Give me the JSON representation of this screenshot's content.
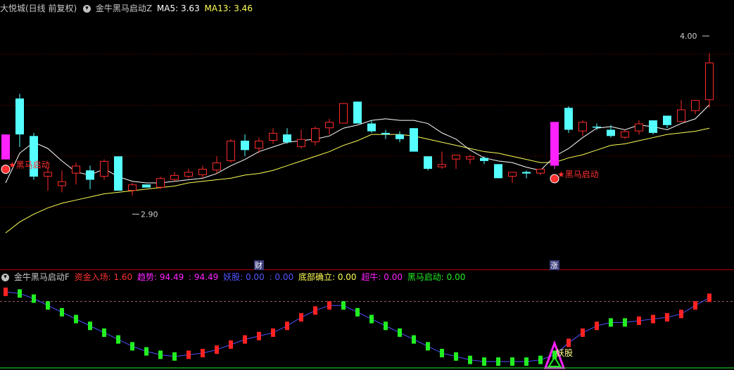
{
  "header_top": {
    "stock": "大悦城(日线 前复权)",
    "indicator": "金牛黑马启动Z",
    "ma5_label": "MA5:",
    "ma5_value": "3.63",
    "ma13_label": "MA13:",
    "ma13_value": "3.46"
  },
  "header_bottom": {
    "indicator": "金牛黑马启动F",
    "funds_label": "资金入场:",
    "funds_value": "1.60",
    "trend_label": "趋势:",
    "trend_value1": "94.49",
    "trend_value2": "94.49",
    "yao_label": "妖股:",
    "yao_value1": "0.00",
    "yao_value2": "0.00",
    "bottom_label": "底部确立:",
    "bottom_value": "0.00",
    "super_label": "超牛:",
    "super_value": "0.00",
    "hm_label": "黑马启动:",
    "hm_value": "0.00"
  },
  "annotations": {
    "high_price": "4.00",
    "low_price": "2.90",
    "signal_text": "★黑马启动",
    "event_cai": "财",
    "event_zhang": "涨",
    "yao_text": "妖股"
  },
  "colors": {
    "up": "#ff2a2a",
    "down": "#55ffff",
    "signal": "#ff22ff",
    "ma5": "#ffffff",
    "ma13": "#ffff55",
    "separator": "#b00000",
    "green_bar": "#22ee22",
    "red_bar": "#ff2222"
  },
  "chart_data": {
    "type": "candlestick",
    "candles": [
      {
        "o": 3.26,
        "c": 3.42,
        "h": 3.42,
        "l": 3.26,
        "color": "signal"
      },
      {
        "o": 3.65,
        "c": 3.42,
        "h": 3.68,
        "l": 3.34,
        "color": "down"
      },
      {
        "o": 3.41,
        "c": 3.15,
        "h": 3.43,
        "l": 3.13,
        "color": "down"
      },
      {
        "o": 3.15,
        "c": 3.18,
        "h": 3.21,
        "l": 3.06,
        "color": "up"
      },
      {
        "o": 3.09,
        "c": 3.12,
        "h": 3.19,
        "l": 3.05,
        "color": "up"
      },
      {
        "o": 3.17,
        "c": 3.22,
        "h": 3.24,
        "l": 3.1,
        "color": "up"
      },
      {
        "o": 3.19,
        "c": 3.13,
        "h": 3.22,
        "l": 3.07,
        "color": "down"
      },
      {
        "o": 3.15,
        "c": 3.25,
        "h": 3.26,
        "l": 3.13,
        "color": "up"
      },
      {
        "o": 3.28,
        "c": 3.06,
        "h": 3.28,
        "l": 3.06,
        "color": "down"
      },
      {
        "o": 3.06,
        "c": 3.1,
        "h": 3.11,
        "l": 3.03,
        "color": "up"
      },
      {
        "o": 3.1,
        "c": 3.08,
        "h": 3.1,
        "l": 3.08,
        "color": "down"
      },
      {
        "o": 3.08,
        "c": 3.14,
        "h": 3.15,
        "l": 3.07,
        "color": "up"
      },
      {
        "o": 3.13,
        "c": 3.16,
        "h": 3.18,
        "l": 3.12,
        "color": "up"
      },
      {
        "o": 3.15,
        "c": 3.18,
        "h": 3.2,
        "l": 3.14,
        "color": "up"
      },
      {
        "o": 3.16,
        "c": 3.2,
        "h": 3.22,
        "l": 3.14,
        "color": "up"
      },
      {
        "o": 3.19,
        "c": 3.24,
        "h": 3.28,
        "l": 3.17,
        "color": "up"
      },
      {
        "o": 3.25,
        "c": 3.38,
        "h": 3.39,
        "l": 3.24,
        "color": "up"
      },
      {
        "o": 3.38,
        "c": 3.32,
        "h": 3.42,
        "l": 3.28,
        "color": "down"
      },
      {
        "o": 3.33,
        "c": 3.38,
        "h": 3.4,
        "l": 3.3,
        "color": "up"
      },
      {
        "o": 3.38,
        "c": 3.43,
        "h": 3.46,
        "l": 3.36,
        "color": "up"
      },
      {
        "o": 3.42,
        "c": 3.37,
        "h": 3.46,
        "l": 3.36,
        "color": "down"
      },
      {
        "o": 3.34,
        "c": 3.39,
        "h": 3.45,
        "l": 3.33,
        "color": "up"
      },
      {
        "o": 3.37,
        "c": 3.46,
        "h": 3.47,
        "l": 3.35,
        "color": "up"
      },
      {
        "o": 3.46,
        "c": 3.5,
        "h": 3.52,
        "l": 3.42,
        "color": "up"
      },
      {
        "o": 3.49,
        "c": 3.62,
        "h": 3.62,
        "l": 3.49,
        "color": "up"
      },
      {
        "o": 3.63,
        "c": 3.49,
        "h": 3.63,
        "l": 3.49,
        "color": "down"
      },
      {
        "o": 3.49,
        "c": 3.44,
        "h": 3.51,
        "l": 3.43,
        "color": "down"
      },
      {
        "o": 3.43,
        "c": 3.42,
        "h": 3.45,
        "l": 3.39,
        "color": "down"
      },
      {
        "o": 3.42,
        "c": 3.39,
        "h": 3.44,
        "l": 3.37,
        "color": "down"
      },
      {
        "o": 3.46,
        "c": 3.31,
        "h": 3.46,
        "l": 3.31,
        "color": "down"
      },
      {
        "o": 3.28,
        "c": 3.2,
        "h": 3.28,
        "l": 3.19,
        "color": "down"
      },
      {
        "o": 3.23,
        "c": 3.21,
        "h": 3.31,
        "l": 3.2,
        "color": "up"
      },
      {
        "o": 3.26,
        "c": 3.29,
        "h": 3.29,
        "l": 3.2,
        "color": "up"
      },
      {
        "o": 3.26,
        "c": 3.28,
        "h": 3.29,
        "l": 3.23,
        "color": "up"
      },
      {
        "o": 3.27,
        "c": 3.25,
        "h": 3.28,
        "l": 3.23,
        "color": "down"
      },
      {
        "o": 3.23,
        "c": 3.14,
        "h": 3.23,
        "l": 3.14,
        "color": "down"
      },
      {
        "o": 3.15,
        "c": 3.18,
        "h": 3.18,
        "l": 3.11,
        "color": "up"
      },
      {
        "o": 3.18,
        "c": 3.17,
        "h": 3.19,
        "l": 3.14,
        "color": "down"
      },
      {
        "o": 3.17,
        "c": 3.2,
        "h": 3.2,
        "l": 3.16,
        "color": "up"
      },
      {
        "o": 3.22,
        "c": 3.5,
        "h": 3.5,
        "l": 3.2,
        "color": "signal"
      },
      {
        "o": 3.59,
        "c": 3.45,
        "h": 3.6,
        "l": 3.43,
        "color": "down"
      },
      {
        "o": 3.44,
        "c": 3.5,
        "h": 3.51,
        "l": 3.41,
        "color": "up"
      },
      {
        "o": 3.47,
        "c": 3.47,
        "h": 3.49,
        "l": 3.45,
        "color": "down"
      },
      {
        "o": 3.45,
        "c": 3.41,
        "h": 3.48,
        "l": 3.4,
        "color": "down"
      },
      {
        "o": 3.4,
        "c": 3.44,
        "h": 3.45,
        "l": 3.39,
        "color": "up"
      },
      {
        "o": 3.44,
        "c": 3.49,
        "h": 3.51,
        "l": 3.42,
        "color": "up"
      },
      {
        "o": 3.51,
        "c": 3.43,
        "h": 3.51,
        "l": 3.42,
        "color": "down"
      },
      {
        "o": 3.48,
        "c": 3.54,
        "h": 3.54,
        "l": 3.46,
        "color": "down"
      },
      {
        "o": 3.5,
        "c": 3.58,
        "h": 3.64,
        "l": 3.5,
        "color": "up"
      },
      {
        "o": 3.57,
        "c": 3.64,
        "h": 3.64,
        "l": 3.55,
        "color": "up"
      },
      {
        "o": 3.64,
        "c": 3.88,
        "h": 3.94,
        "l": 3.59,
        "color": "up"
      }
    ],
    "ma5": [
      3.11,
      3.3,
      3.37,
      3.33,
      3.25,
      3.18,
      3.16,
      3.2,
      3.15,
      3.12,
      3.11,
      3.11,
      3.12,
      3.13,
      3.14,
      3.17,
      3.22,
      3.26,
      3.31,
      3.34,
      3.37,
      3.38,
      3.39,
      3.41,
      3.46,
      3.48,
      3.51,
      3.52,
      3.51,
      3.51,
      3.49,
      3.43,
      3.39,
      3.32,
      3.27,
      3.25,
      3.24,
      3.21,
      3.19,
      3.28,
      3.33,
      3.4,
      3.46,
      3.47,
      3.45,
      3.48,
      3.47,
      3.45,
      3.49,
      3.52,
      3.61
    ],
    "ma13": [
      2.79,
      2.86,
      2.91,
      2.95,
      2.98,
      3.0,
      3.02,
      3.04,
      3.05,
      3.06,
      3.07,
      3.08,
      3.09,
      3.11,
      3.12,
      3.13,
      3.14,
      3.16,
      3.17,
      3.19,
      3.22,
      3.25,
      3.28,
      3.31,
      3.35,
      3.38,
      3.42,
      3.42,
      3.42,
      3.41,
      3.39,
      3.37,
      3.35,
      3.33,
      3.31,
      3.3,
      3.28,
      3.26,
      3.24,
      3.24,
      3.27,
      3.29,
      3.32,
      3.35,
      3.36,
      3.38,
      3.4,
      3.42,
      3.43,
      3.44,
      3.46
    ],
    "sub_values": [
      98,
      97,
      94,
      90,
      86,
      82,
      78,
      74,
      70,
      66,
      63,
      61,
      60,
      61,
      62,
      64,
      67,
      70,
      72,
      74,
      78,
      83,
      87,
      90,
      90,
      86,
      82,
      78,
      74,
      70,
      66,
      62,
      60,
      58,
      57,
      57,
      57,
      57,
      58,
      61,
      68,
      74,
      78,
      80,
      80,
      81,
      82,
      83,
      85,
      90,
      94.49
    ],
    "sub_colors": [
      "r",
      "g",
      "g",
      "g",
      "g",
      "g",
      "g",
      "g",
      "g",
      "g",
      "g",
      "g",
      "g",
      "r",
      "r",
      "r",
      "r",
      "r",
      "r",
      "r",
      "r",
      "r",
      "r",
      "r",
      "g",
      "g",
      "g",
      "g",
      "g",
      "g",
      "g",
      "g",
      "g",
      "g",
      "g",
      "g",
      "g",
      "g",
      "g",
      "g",
      "r",
      "r",
      "r",
      "g",
      "g",
      "r",
      "r",
      "r",
      "r",
      "r",
      "r"
    ]
  }
}
